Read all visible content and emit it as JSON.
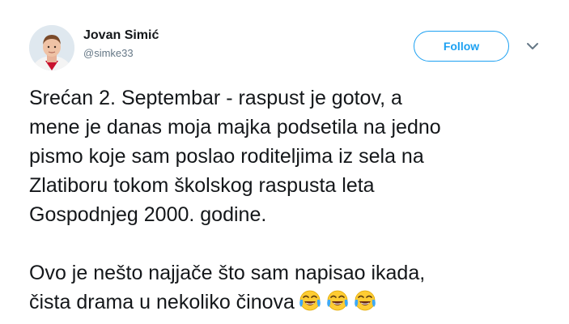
{
  "author": {
    "display_name": "Jovan Simić",
    "handle": "@simke33"
  },
  "actions": {
    "follow_label": "Follow",
    "more_icon": "chevron-down-icon"
  },
  "colors": {
    "accent": "#1da1f2",
    "text": "#14171a",
    "secondary_text": "#657786"
  },
  "tweet": {
    "paragraph_1": [
      "Srećan 2. Septembar - raspust je gotov, a",
      "mene je danas moja majka podsetila na jedno",
      "pismo koje sam poslao roditeljima iz sela na",
      "Zlatiboru tokom školskog raspusta leta",
      "Gospodnjeg 2000. godine."
    ],
    "paragraph_2": [
      "Ovo je nešto najjače što sam napisao ikada,",
      "čista drama u nekoliko činova"
    ],
    "trailing_emoji": [
      "face-with-tears-of-joy",
      "face-with-tears-of-joy",
      "face-with-tears-of-joy"
    ]
  }
}
